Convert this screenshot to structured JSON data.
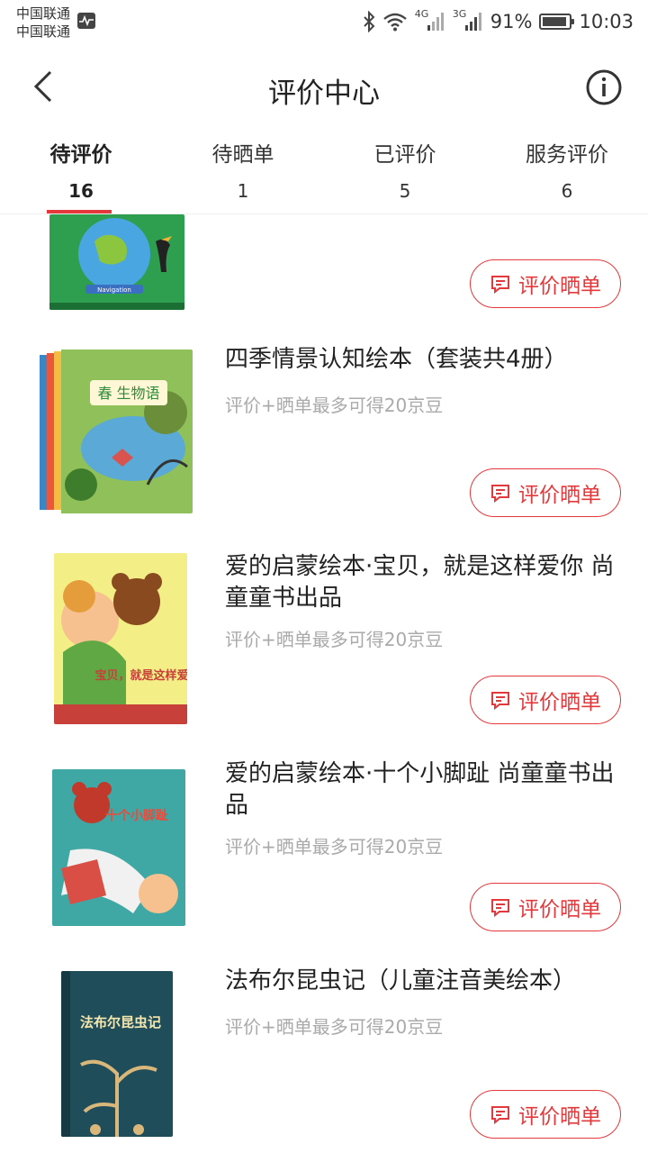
{
  "status_bar": {
    "carrier_1": "中国联通",
    "carrier_2": "中国联通",
    "network_1": "4G",
    "network_2": "3G",
    "battery_percent": "91%",
    "battery_level": 0.91,
    "time": "10:03"
  },
  "header": {
    "title": "评价中心",
    "back_icon": "chevron-left-icon",
    "info_icon": "info-circle-icon"
  },
  "tabs": [
    {
      "label": "待评价",
      "count": "16",
      "active": true
    },
    {
      "label": "待晒单",
      "count": "1",
      "active": false
    },
    {
      "label": "已评价",
      "count": "5",
      "active": false
    },
    {
      "label": "服务评价",
      "count": "6",
      "active": false
    }
  ],
  "items": [
    {
      "title": "",
      "hint": "",
      "button_label": "评价晒单",
      "cover_text": "Navigation"
    },
    {
      "title": "四季情景认知绘本（套装共4册）",
      "hint": "评价+晒单最多可得20京豆",
      "button_label": "评价晒单",
      "cover_text": "春 生物语"
    },
    {
      "title": "爱的启蒙绘本·宝贝，就是这样爱你 尚童童书出品",
      "hint": "评价+晒单最多可得20京豆",
      "button_label": "评价晒单",
      "cover_text": "宝贝，就是这样爱你"
    },
    {
      "title": "爱的启蒙绘本·十个小脚趾 尚童童书出品",
      "hint": "评价+晒单最多可得20京豆",
      "button_label": "评价晒单",
      "cover_text": "十个小脚趾"
    },
    {
      "title": "法布尔昆虫记（儿童注音美绘本）",
      "hint": "评价+晒单最多可得20京豆",
      "button_label": "评价晒单",
      "cover_text": "法布尔昆虫记"
    }
  ],
  "colors": {
    "accent": "#e4393c",
    "hint_text": "#aaaaaa",
    "title_text": "#222222"
  }
}
